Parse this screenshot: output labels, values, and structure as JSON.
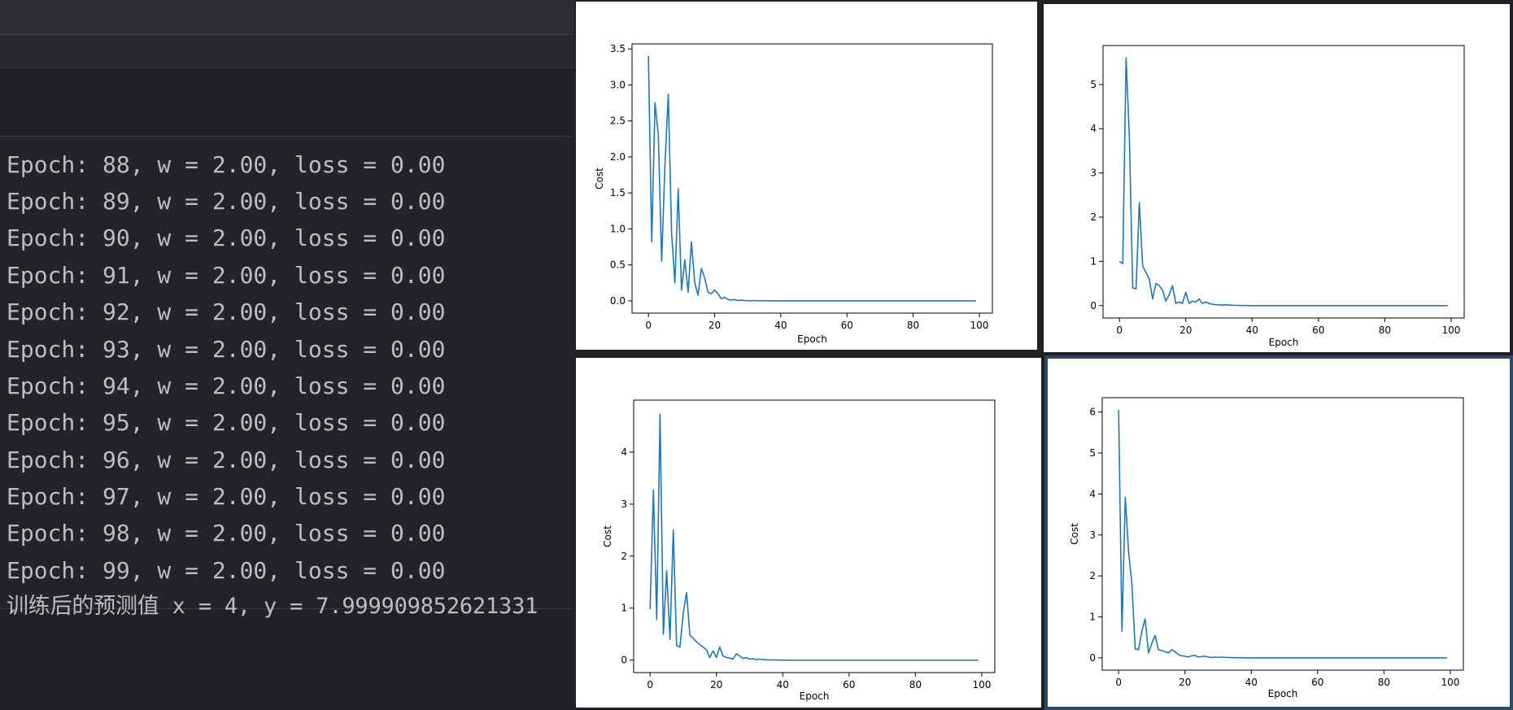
{
  "console": {
    "lines": [
      "Epoch: 88, w = 2.00, loss = 0.00",
      "Epoch: 89, w = 2.00, loss = 0.00",
      "Epoch: 90, w = 2.00, loss = 0.00",
      "Epoch: 91, w = 2.00, loss = 0.00",
      "Epoch: 92, w = 2.00, loss = 0.00",
      "Epoch: 93, w = 2.00, loss = 0.00",
      "Epoch: 94, w = 2.00, loss = 0.00",
      "Epoch: 95, w = 2.00, loss = 0.00",
      "Epoch: 96, w = 2.00, loss = 0.00",
      "Epoch: 97, w = 2.00, loss = 0.00",
      "Epoch: 98, w = 2.00, loss = 0.00",
      "Epoch: 99, w = 2.00, loss = 0.00"
    ],
    "final_line": "训练后的预测值 x = 4, y = 7.999909852621331"
  },
  "chart_data": [
    {
      "type": "line",
      "xlabel": "Epoch",
      "ylabel": "Cost",
      "xlim": [
        -4.95,
        103.95
      ],
      "ylim": [
        -0.17,
        3.57
      ],
      "xticks": [
        "0",
        "20",
        "40",
        "60",
        "80",
        "100"
      ],
      "yticks": [
        "0.0",
        "0.5",
        "1.0",
        "1.5",
        "2.0",
        "2.5",
        "3.0",
        "3.5"
      ],
      "ytick_values": [
        0,
        0.5,
        1,
        1.5,
        2,
        2.5,
        3,
        3.5
      ],
      "color": "#1f77b4",
      "series": [
        {
          "x": [
            0,
            1,
            2,
            3,
            4,
            5,
            6,
            7,
            8,
            9,
            10,
            11,
            12,
            13,
            14,
            15,
            16,
            17,
            18,
            19,
            20,
            21,
            22,
            23,
            24,
            25,
            26,
            27,
            28,
            29,
            30,
            31,
            32,
            33,
            34,
            35,
            40,
            50,
            60,
            70,
            80,
            90,
            99
          ],
          "values": [
            3.4,
            0.82,
            2.75,
            2.3,
            0.55,
            1.9,
            2.87,
            0.95,
            0.25,
            1.56,
            0.15,
            0.57,
            0.12,
            0.82,
            0.25,
            0.08,
            0.45,
            0.32,
            0.12,
            0.1,
            0.15,
            0.1,
            0.03,
            0.05,
            0.02,
            0.01,
            0.02,
            0.005,
            0.01,
            0.005,
            0.003,
            0.002,
            0.005,
            0.002,
            0.001,
            0.001,
            0.0,
            0.0,
            0.0,
            0.0,
            0.0,
            0.0,
            0.0
          ]
        }
      ]
    },
    {
      "type": "line",
      "xlabel": "Epoch",
      "ylabel": "",
      "xlim": [
        -4.95,
        103.95
      ],
      "ylim": [
        -0.28,
        5.88
      ],
      "xticks": [
        "0",
        "20",
        "40",
        "60",
        "80",
        "100"
      ],
      "yticks": [
        "0",
        "1",
        "2",
        "3",
        "4",
        "5"
      ],
      "ytick_values": [
        0,
        1,
        2,
        3,
        4,
        5
      ],
      "color": "#1f77b4",
      "series": [
        {
          "x": [
            0,
            1,
            2,
            3,
            4,
            5,
            6,
            7,
            8,
            9,
            10,
            11,
            12,
            13,
            14,
            15,
            16,
            17,
            18,
            19,
            20,
            21,
            22,
            23,
            24,
            25,
            26,
            27,
            28,
            29,
            30,
            31,
            32,
            33,
            34,
            35,
            40,
            50,
            60,
            70,
            80,
            90,
            99
          ],
          "values": [
            1.0,
            0.95,
            5.6,
            3.8,
            0.4,
            0.38,
            2.33,
            0.9,
            0.75,
            0.6,
            0.15,
            0.5,
            0.45,
            0.35,
            0.1,
            0.25,
            0.45,
            0.05,
            0.08,
            0.05,
            0.3,
            0.05,
            0.1,
            0.08,
            0.15,
            0.05,
            0.08,
            0.05,
            0.03,
            0.02,
            0.02,
            0.01,
            0.02,
            0.01,
            0.01,
            0.005,
            0.0,
            0.0,
            0.0,
            0.0,
            0.0,
            0.0,
            0.0
          ]
        }
      ]
    },
    {
      "type": "line",
      "xlabel": "Epoch",
      "ylabel": "Cost",
      "xlim": [
        -4.95,
        103.95
      ],
      "ylim": [
        -0.24,
        5.0
      ],
      "xticks": [
        "0",
        "20",
        "40",
        "60",
        "80",
        "100"
      ],
      "yticks": [
        "0",
        "1",
        "2",
        "3",
        "4"
      ],
      "ytick_values": [
        0,
        1,
        2,
        3,
        4
      ],
      "color": "#1f77b4",
      "series": [
        {
          "x": [
            0,
            1,
            2,
            3,
            4,
            5,
            6,
            7,
            8,
            9,
            10,
            11,
            12,
            13,
            14,
            15,
            16,
            17,
            18,
            19,
            20,
            21,
            22,
            23,
            24,
            25,
            26,
            27,
            28,
            29,
            30,
            31,
            32,
            33,
            34,
            35,
            40,
            50,
            60,
            70,
            80,
            90,
            99
          ],
          "values": [
            0.98,
            3.27,
            0.78,
            4.73,
            0.5,
            1.72,
            0.4,
            2.5,
            0.28,
            0.25,
            0.9,
            1.3,
            0.48,
            0.42,
            0.35,
            0.3,
            0.25,
            0.2,
            0.05,
            0.18,
            0.05,
            0.25,
            0.08,
            0.05,
            0.04,
            0.02,
            0.12,
            0.08,
            0.03,
            0.05,
            0.02,
            0.03,
            0.01,
            0.02,
            0.01,
            0.005,
            0.0,
            0.0,
            0.0,
            0.0,
            0.0,
            0.0,
            0.0
          ]
        }
      ]
    },
    {
      "type": "line",
      "xlabel": "Epoch",
      "ylabel": "Cost",
      "xlim": [
        -4.95,
        103.95
      ],
      "ylim": [
        -0.3,
        6.35
      ],
      "xticks": [
        "0",
        "20",
        "40",
        "60",
        "80",
        "100"
      ],
      "yticks": [
        "0",
        "1",
        "2",
        "3",
        "4",
        "5",
        "6"
      ],
      "ytick_values": [
        0,
        1,
        2,
        3,
        4,
        5,
        6
      ],
      "color": "#1f77b4",
      "series": [
        {
          "x": [
            0,
            1,
            2,
            3,
            4,
            5,
            6,
            7,
            8,
            9,
            10,
            11,
            12,
            13,
            14,
            15,
            16,
            17,
            18,
            19,
            20,
            21,
            22,
            23,
            24,
            25,
            26,
            27,
            28,
            29,
            30,
            31,
            32,
            33,
            34,
            35,
            40,
            50,
            60,
            70,
            80,
            90,
            99
          ],
          "values": [
            6.05,
            0.65,
            3.92,
            2.6,
            1.8,
            0.22,
            0.2,
            0.65,
            0.95,
            0.12,
            0.35,
            0.55,
            0.2,
            0.18,
            0.15,
            0.12,
            0.2,
            0.15,
            0.08,
            0.05,
            0.04,
            0.02,
            0.05,
            0.06,
            0.02,
            0.03,
            0.04,
            0.02,
            0.01,
            0.02,
            0.01,
            0.02,
            0.01,
            0.01,
            0.005,
            0.005,
            0.0,
            0.0,
            0.0,
            0.0,
            0.0,
            0.0,
            0.0
          ]
        }
      ]
    }
  ]
}
